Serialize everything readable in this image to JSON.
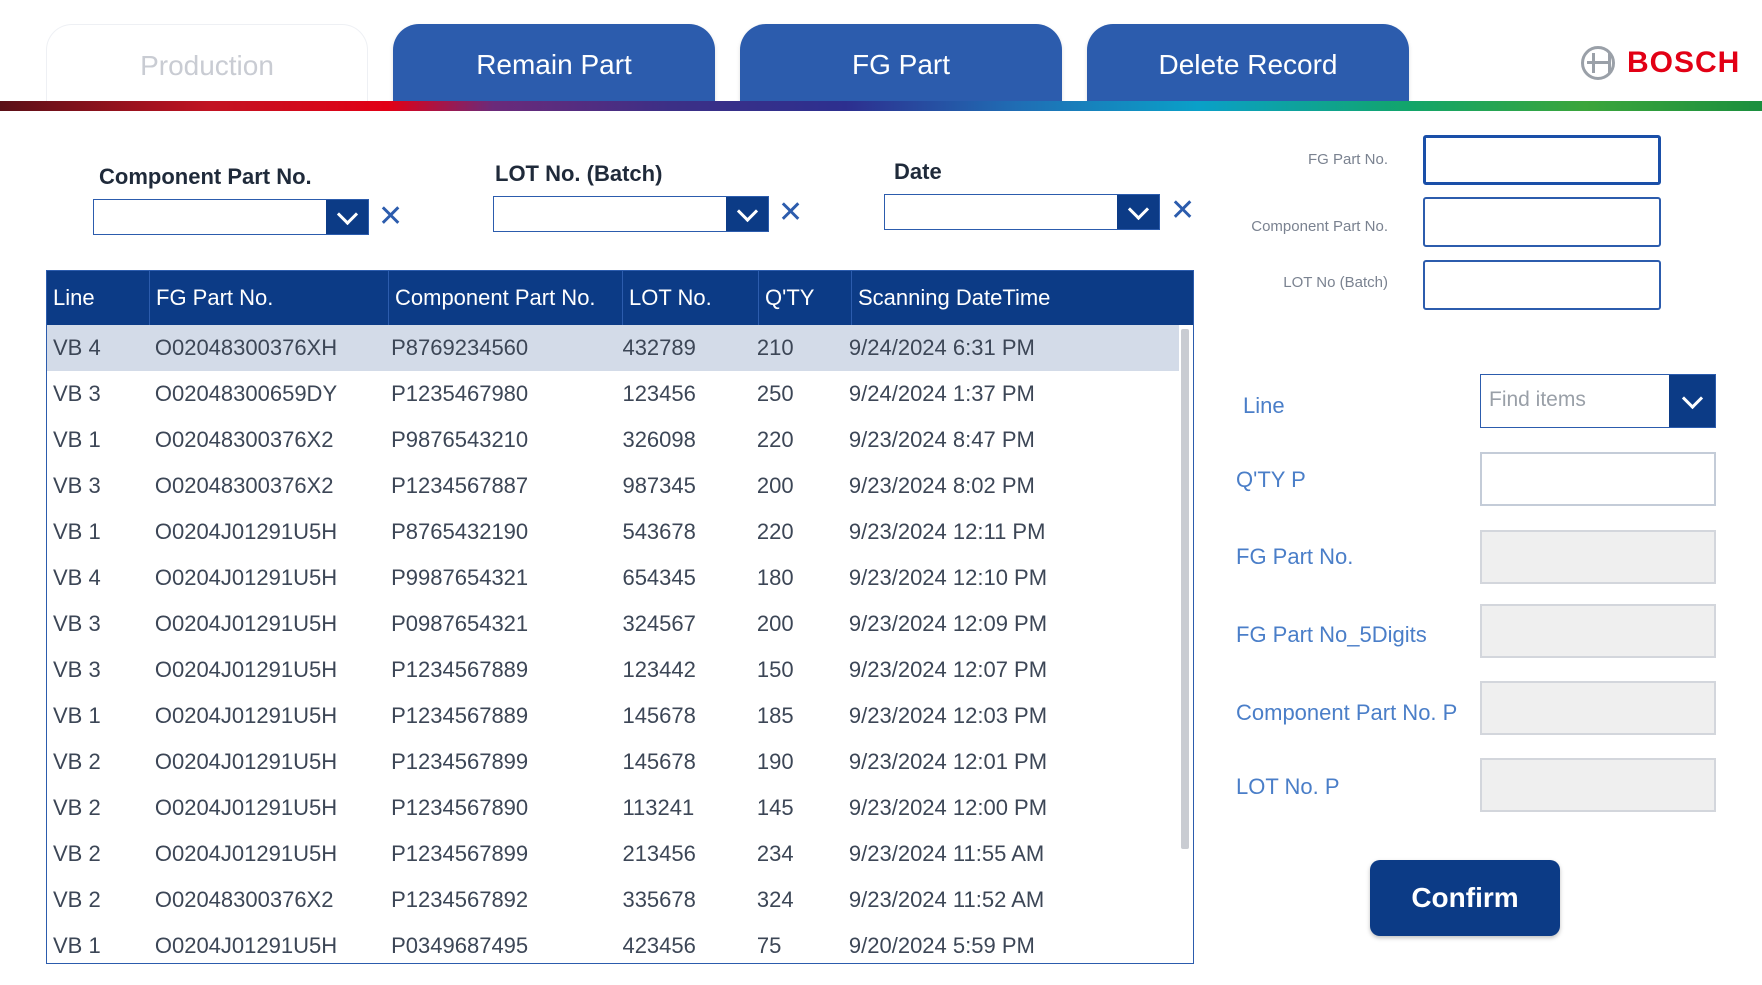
{
  "tabs": [
    {
      "label": "Production",
      "active": true
    },
    {
      "label": "Remain Part",
      "active": false
    },
    {
      "label": "FG Part",
      "active": false
    },
    {
      "label": "Delete Record",
      "active": false
    }
  ],
  "brand": {
    "name": "BOSCH",
    "color": "#e20015"
  },
  "filters": {
    "component_part_no": {
      "label": "Component Part No.",
      "value": ""
    },
    "lot_no": {
      "label": "LOT No. (Batch)",
      "value": ""
    },
    "date": {
      "label": "Date",
      "value": ""
    },
    "clear_symbol": "✕"
  },
  "table": {
    "columns": [
      "Line",
      "FG Part No.",
      "Component Part No.",
      "LOT No.",
      "Q'TY",
      "Scanning DateTime"
    ],
    "selected_row": 0,
    "rows": [
      [
        "VB 4",
        "O02048300376XH",
        "P8769234560",
        "432789",
        "210",
        "9/24/2024 6:31 PM"
      ],
      [
        "VB 3",
        "O02048300659DY",
        "P1235467980",
        "123456",
        "250",
        "9/24/2024 1:37 PM"
      ],
      [
        "VB 1",
        "O02048300376X2",
        "P9876543210",
        "326098",
        "220",
        "9/23/2024 8:47 PM"
      ],
      [
        "VB 3",
        "O02048300376X2",
        "P1234567887",
        "987345",
        "200",
        "9/23/2024 8:02 PM"
      ],
      [
        "VB 1",
        "O0204J01291U5H",
        "P8765432190",
        "543678",
        "220",
        "9/23/2024 12:11 PM"
      ],
      [
        "VB 4",
        "O0204J01291U5H",
        "P9987654321",
        "654345",
        "180",
        "9/23/2024 12:10 PM"
      ],
      [
        "VB 3",
        "O0204J01291U5H",
        "P0987654321",
        "324567",
        "200",
        "9/23/2024 12:09 PM"
      ],
      [
        "VB 3",
        "O0204J01291U5H",
        "P1234567889",
        "123442",
        "150",
        "9/23/2024 12:07 PM"
      ],
      [
        "VB 1",
        "O0204J01291U5H",
        "P1234567889",
        "145678",
        "185",
        "9/23/2024 12:03 PM"
      ],
      [
        "VB 2",
        "O0204J01291U5H",
        "P1234567899",
        "145678",
        "190",
        "9/23/2024 12:01 PM"
      ],
      [
        "VB 2",
        "O0204J01291U5H",
        "P1234567890",
        "113241",
        "145",
        "9/23/2024 12:00 PM"
      ],
      [
        "VB 2",
        "O0204J01291U5H",
        "P1234567899",
        "213456",
        "234",
        "9/23/2024 11:55 AM"
      ],
      [
        "VB 2",
        "O02048300376X2",
        "P1234567892",
        "335678",
        "324",
        "9/23/2024 11:52 AM"
      ],
      [
        "VB 1",
        "O0204J01291U5H",
        "P0349687495",
        "423456",
        "75",
        "9/20/2024 5:59 PM"
      ]
    ]
  },
  "scan_inputs": {
    "fg_part_no": {
      "label": "FG Part No.",
      "value": ""
    },
    "component_part_no": {
      "label": "Component Part No.",
      "value": ""
    },
    "lot_no": {
      "label": "LOT No (Batch)",
      "value": ""
    }
  },
  "form": {
    "line": {
      "label": "Line",
      "placeholder": "Find items"
    },
    "qty_p": {
      "label": "Q'TY P",
      "value": ""
    },
    "fg_part_no": {
      "label": "FG Part No.",
      "value": ""
    },
    "fg_part_no_5digits": {
      "label": "FG Part No_5Digits",
      "value": ""
    },
    "component_part_no_p": {
      "label": "Component Part No. P",
      "value": ""
    },
    "lot_no_p": {
      "label": "LOT No. P",
      "value": ""
    },
    "confirm_label": "Confirm"
  },
  "colors": {
    "primary": "#0c3b86",
    "tab_blue": "#2c5cad",
    "label_blue": "#4a7ec8",
    "selected_row": "#d3dbe8"
  }
}
